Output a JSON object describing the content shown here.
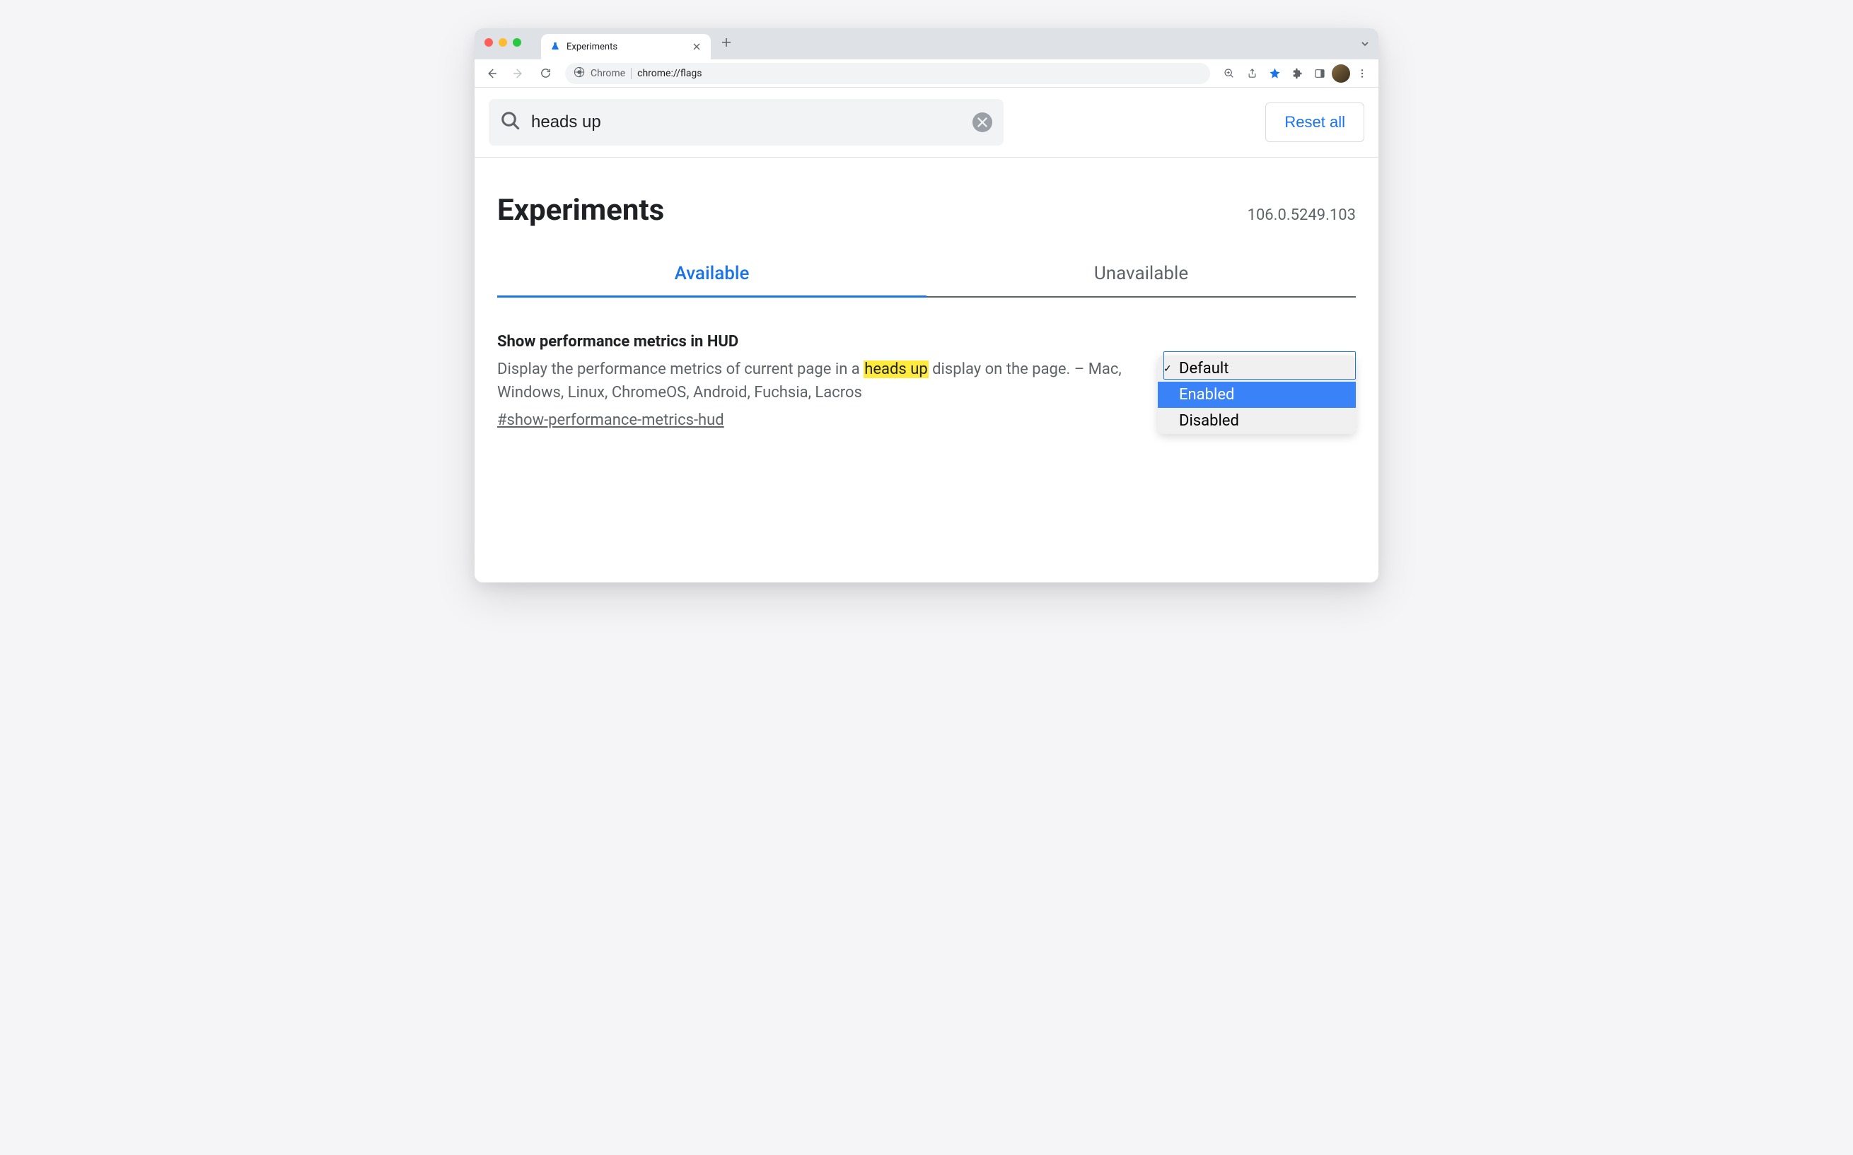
{
  "browser": {
    "tab_title": "Experiments",
    "omnibox": {
      "site_label": "Chrome",
      "url_display": "chrome://flags"
    }
  },
  "page": {
    "search": {
      "value": "heads up"
    },
    "reset_label": "Reset all",
    "title": "Experiments",
    "version": "106.0.5249.103",
    "tabs": [
      {
        "label": "Available",
        "selected": true
      },
      {
        "label": "Unavailable",
        "selected": false
      }
    ],
    "flag": {
      "title": "Show performance metrics in HUD",
      "desc_before": "Display the performance metrics of current page in a ",
      "desc_highlight": "heads up",
      "desc_after": " display on the page. – Mac, Windows, Linux, ChromeOS, Android, Fuchsia, Lacros",
      "anchor": "#show-performance-metrics-hud",
      "dropdown": {
        "options": [
          "Default",
          "Enabled",
          "Disabled"
        ],
        "checked_index": 0,
        "highlighted_index": 1
      }
    }
  }
}
